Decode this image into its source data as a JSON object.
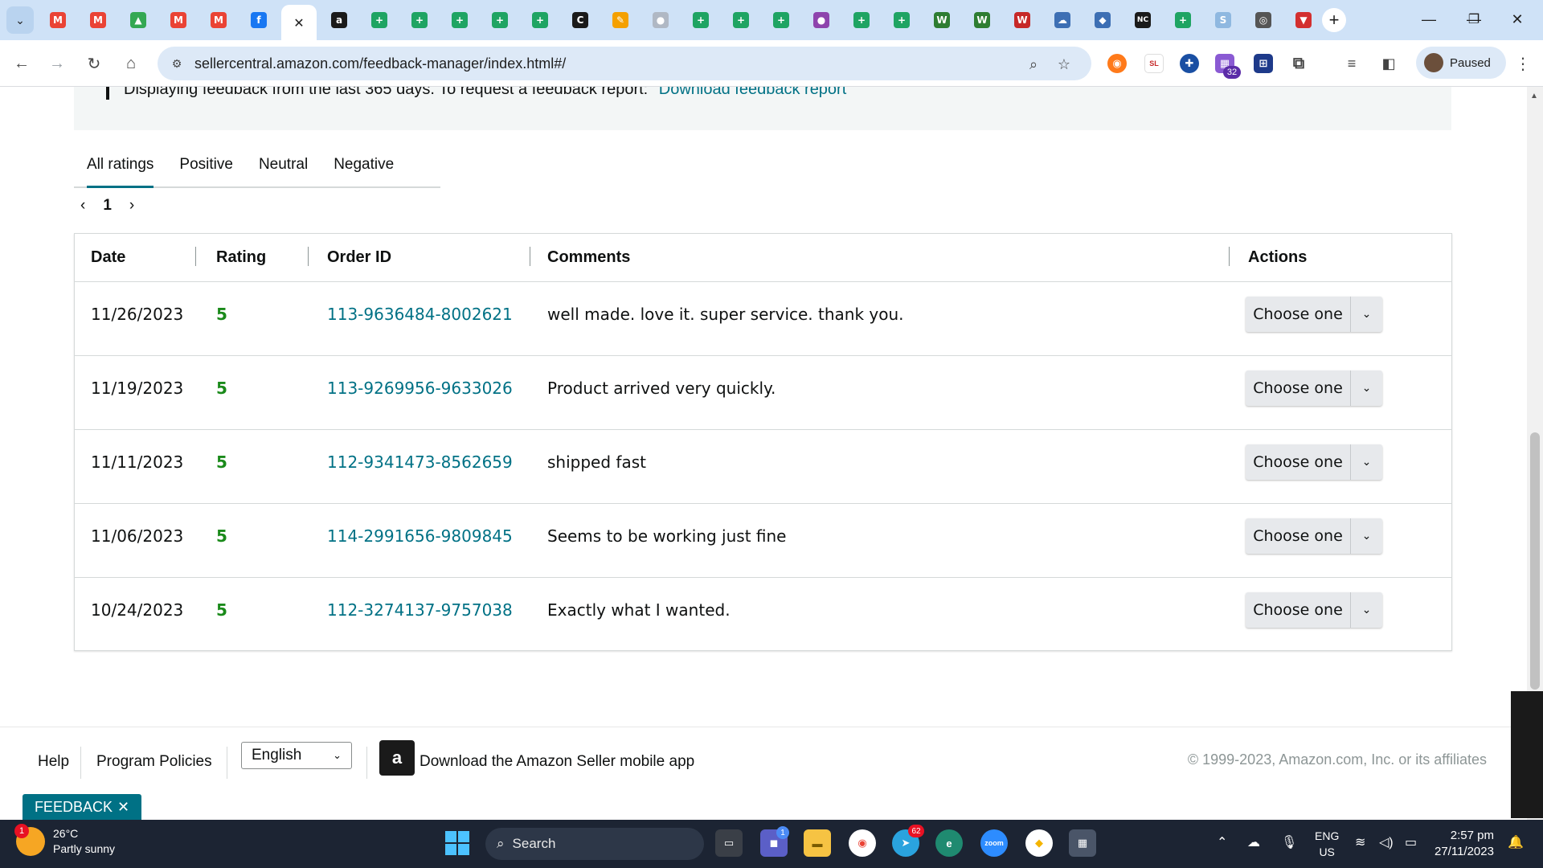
{
  "browser": {
    "tabs": [
      {
        "icon": "gmail-icon",
        "glyph": "M",
        "color": "#ea4335"
      },
      {
        "icon": "gmail-icon",
        "glyph": "M",
        "color": "#ea4335"
      },
      {
        "icon": "google-drive-icon",
        "glyph": "▲",
        "color": "#34a853"
      },
      {
        "icon": "gmail-icon",
        "glyph": "M",
        "color": "#ea4335"
      },
      {
        "icon": "gmail-icon",
        "glyph": "M",
        "color": "#ea4335"
      },
      {
        "icon": "facebook-icon",
        "glyph": "f",
        "color": "#1877f2"
      },
      {
        "icon": "close-icon",
        "glyph": "✕",
        "color": "#1f1f1f",
        "active": true
      },
      {
        "icon": "amazon-icon",
        "glyph": "a",
        "color": "#1a1a1a"
      },
      {
        "icon": "sheets-icon",
        "glyph": "+",
        "color": "#1fa463"
      },
      {
        "icon": "sheets-icon",
        "glyph": "+",
        "color": "#1fa463"
      },
      {
        "icon": "sheets-icon",
        "glyph": "+",
        "color": "#1fa463"
      },
      {
        "icon": "sheets-icon",
        "glyph": "+",
        "color": "#1fa463"
      },
      {
        "icon": "sheets-icon",
        "glyph": "+",
        "color": "#1fa463"
      },
      {
        "icon": "c-logo-icon",
        "glyph": "C",
        "color": "#1a1a1a"
      },
      {
        "icon": "tools-icon",
        "glyph": "✎",
        "color": "#f4a000"
      },
      {
        "icon": "circle-icon",
        "glyph": "●",
        "color": "#b0b8c4"
      },
      {
        "icon": "sheets-icon",
        "glyph": "+",
        "color": "#1fa463"
      },
      {
        "icon": "sheets-icon",
        "glyph": "+",
        "color": "#1fa463"
      },
      {
        "icon": "sheets-icon",
        "glyph": "+",
        "color": "#1fa463"
      },
      {
        "icon": "chat-icon",
        "glyph": "●",
        "color": "#8e44ad"
      },
      {
        "icon": "sheets-icon",
        "glyph": "+",
        "color": "#1fa463"
      },
      {
        "icon": "sheets-icon",
        "glyph": "+",
        "color": "#1fa463"
      },
      {
        "icon": "w-logo-icon",
        "glyph": "W",
        "color": "#2e7d32"
      },
      {
        "icon": "w-logo-icon",
        "glyph": "W",
        "color": "#2e7d32"
      },
      {
        "icon": "w-red-icon",
        "glyph": "W",
        "color": "#c62828"
      },
      {
        "icon": "cloud-icon",
        "glyph": "☁",
        "color": "#3d6fb4"
      },
      {
        "icon": "bird-icon",
        "glyph": "◆",
        "color": "#3d6fb4"
      },
      {
        "icon": "nc-icon",
        "glyph": "NC",
        "color": "#1a1a1a"
      },
      {
        "icon": "sheets-icon",
        "glyph": "+",
        "color": "#1fa463"
      },
      {
        "icon": "sysco-icon",
        "glyph": "S",
        "color": "#8fb8e0"
      },
      {
        "icon": "circle-logo-icon",
        "glyph": "◎",
        "color": "#555"
      },
      {
        "icon": "shield-icon",
        "glyph": "▼",
        "color": "#d32f2f"
      }
    ],
    "url": "sellercentral.amazon.com/feedback-manager/index.html#/",
    "profile_label": "Paused",
    "extension_badge": "32"
  },
  "page": {
    "notice_text": "Displaying feedback from the last 365 days. To request a feedback report:",
    "notice_link": "Download feedback report",
    "rating_tabs": [
      "All ratings",
      "Positive",
      "Neutral",
      "Negative"
    ],
    "page_number": "1",
    "table": {
      "headers": {
        "date": "Date",
        "rating": "Rating",
        "order": "Order ID",
        "comments": "Comments",
        "actions": "Actions"
      },
      "rows": [
        {
          "date": "11/26/2023",
          "rating": "5",
          "order_id": "113-9636484-8002621",
          "comment": "well made. love it. super service. thank you.",
          "action": "Choose one"
        },
        {
          "date": "11/19/2023",
          "rating": "5",
          "order_id": "113-9269956-9633026",
          "comment": "Product arrived very quickly.",
          "action": "Choose one"
        },
        {
          "date": "11/11/2023",
          "rating": "5",
          "order_id": "112-9341473-8562659",
          "comment": "shipped fast",
          "action": "Choose one"
        },
        {
          "date": "11/06/2023",
          "rating": "5",
          "order_id": "114-2991656-9809845",
          "comment": "Seems to be working just fine",
          "action": "Choose one"
        },
        {
          "date": "10/24/2023",
          "rating": "5",
          "order_id": "112-3274137-9757038",
          "comment": "Exactly what I wanted.",
          "action": "Choose one"
        }
      ]
    }
  },
  "footer": {
    "help": "Help",
    "policies": "Program Policies",
    "language": "English",
    "app_text": "Download the Amazon Seller mobile app",
    "copyright": "© 1999-2023, Amazon.com, Inc. or its affiliates",
    "feedback_tab": "FEEDBACK"
  },
  "taskbar": {
    "weather_badge": "1",
    "temperature": "26°C",
    "condition": "Partly sunny",
    "search_label": "Search",
    "language_top": "ENG",
    "language_bottom": "US",
    "time": "2:57 pm",
    "date": "27/11/2023",
    "telegram_badge": "62",
    "chat_badge": "1"
  },
  "colors": {
    "link": "#007185",
    "rating": "#1a8a1a",
    "taskbar": "#1c2433",
    "tabstrip": "#cfe2f7"
  }
}
